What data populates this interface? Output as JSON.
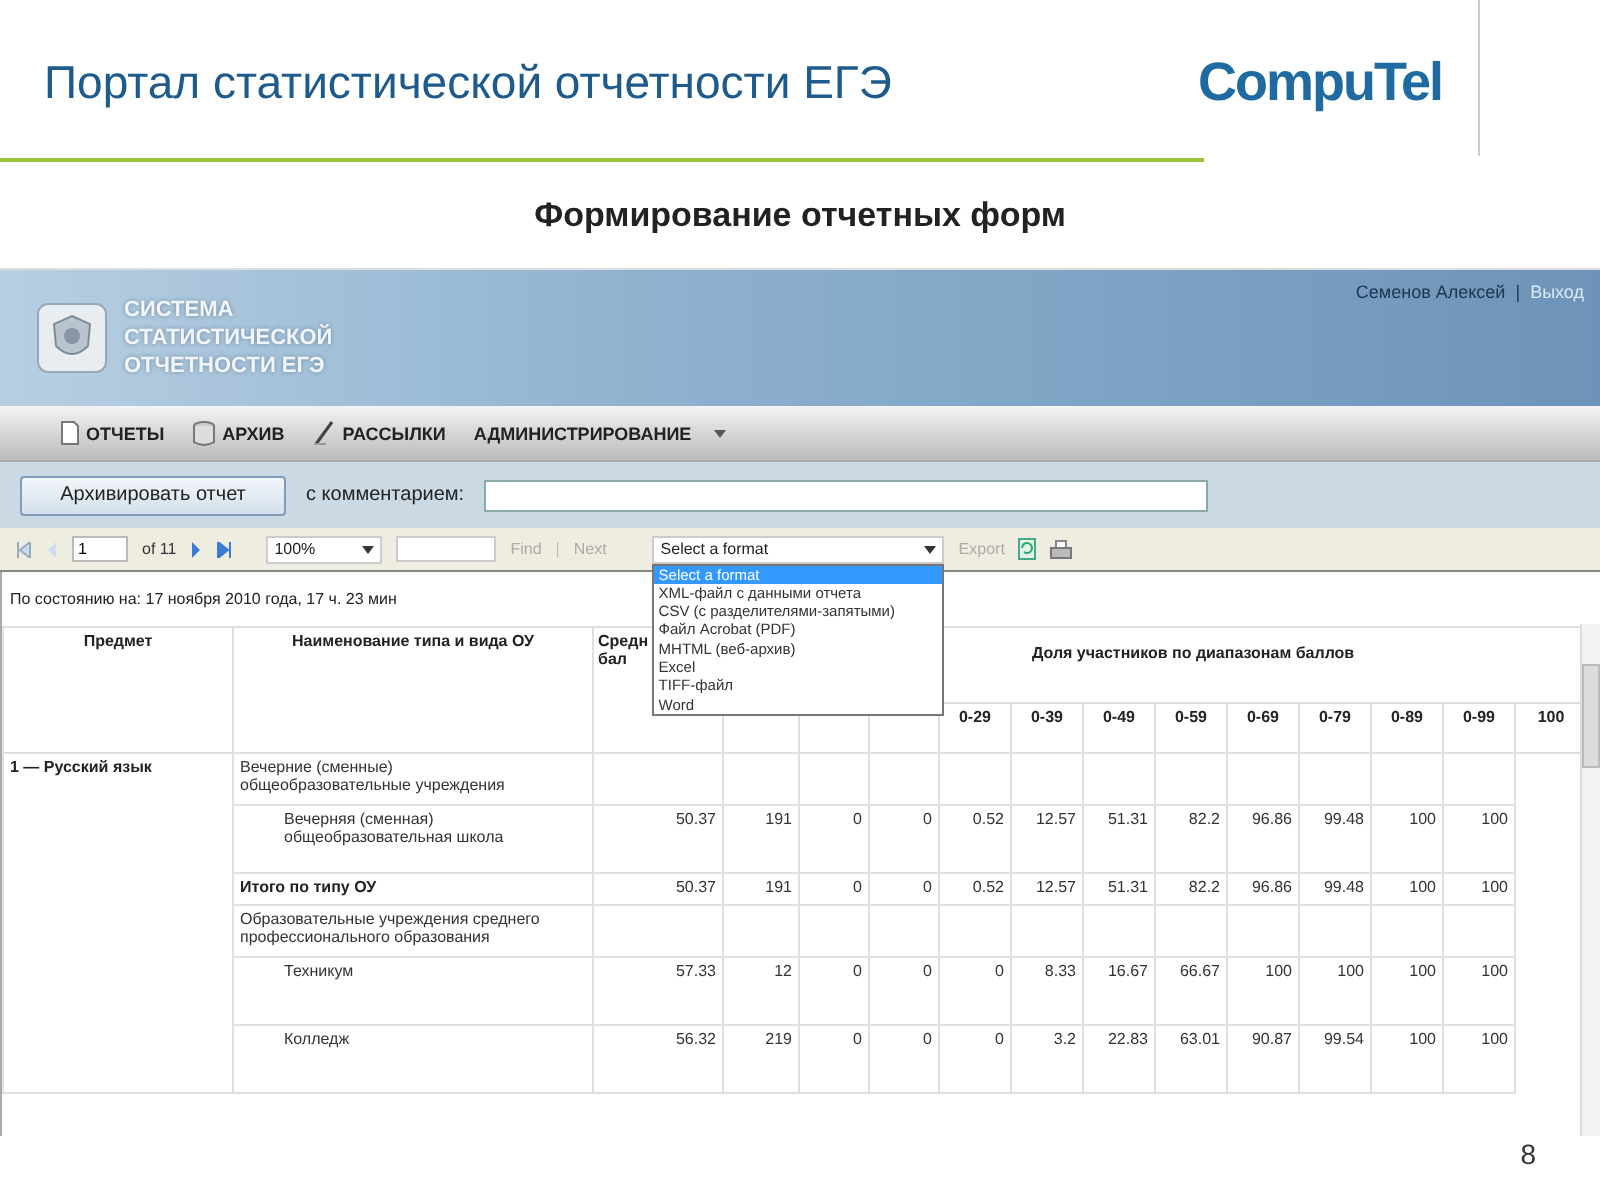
{
  "slide": {
    "title": "Портал статистической отчетности ЕГЭ",
    "logo": "CompuTel",
    "subtitle": "Формирование отчетных форм",
    "page_number": "8"
  },
  "app": {
    "system_name": "СИСТЕМА СТАТИСТИЧЕСКОЙ ОТЧЕТНОСТИ ЕГЭ",
    "user": "Семенов Алексей",
    "separator": "|",
    "logout": "Выход"
  },
  "menu": [
    {
      "label": "ОТЧЕТЫ",
      "kind": "page",
      "dropdown": false
    },
    {
      "label": "АРХИВ",
      "kind": "archive",
      "dropdown": false
    },
    {
      "label": "РАССЫЛКИ",
      "kind": "pen",
      "dropdown": false
    },
    {
      "label": "АДМИНИСТРИРОВАНИЕ",
      "kind": "none",
      "dropdown": true
    }
  ],
  "archive_bar": {
    "button": "Архивировать отчет",
    "comment_label": "с комментарием:"
  },
  "toolbar": {
    "page": "1",
    "page_count": "of 11",
    "zoom": "100%",
    "find": "Find",
    "find_separator": "|",
    "next": "Next",
    "format": "Select a format",
    "format_open": true,
    "export": "Export",
    "format_options": [
      {
        "label": "Select a format",
        "selected": true
      },
      {
        "label": "XML-файл с данными отчета",
        "selected": false
      },
      {
        "label": "CSV (с разделителями-запятыми)",
        "selected": false
      },
      {
        "label": "Файл Acrobat (PDF)",
        "selected": false
      },
      {
        "label": "MHTML (веб-архив)",
        "selected": false
      },
      {
        "label": "Excel",
        "selected": false
      },
      {
        "label": "TIFF-файл",
        "selected": false
      },
      {
        "label": "Word",
        "selected": false
      }
    ]
  },
  "status": "По состоянию на: 17 ноября 2010 года, 17 ч. 23 мин",
  "table": {
    "column_1": "Предмет",
    "column_2": "Наименование типа и вида ОУ",
    "column_3": "Средн бал",
    "group_header": "Доля участников по диапазонам баллов",
    "ranges": [
      "0-29",
      "0-39",
      "0-49",
      "0-59",
      "0-69",
      "0-79",
      "0-89",
      "0-99",
      "100"
    ],
    "subject": "1 — Русский язык",
    "rows": [
      {
        "kind": "group",
        "name": "Вечерние (сменные) общеобразовательные учреждения",
        "values": []
      },
      {
        "kind": "item",
        "name": "Вечерняя (сменная) общеобразовательная школа",
        "values": [
          "50.37",
          "191",
          "0",
          "0",
          "0.52",
          "12.57",
          "51.31",
          "82.2",
          "96.86",
          "99.48",
          "100",
          "100"
        ]
      },
      {
        "kind": "total",
        "name": "Итого по типу ОУ",
        "values": [
          "50.37",
          "191",
          "0",
          "0",
          "0.52",
          "12.57",
          "51.31",
          "82.2",
          "96.86",
          "99.48",
          "100",
          "100"
        ]
      },
      {
        "kind": "group",
        "name": "Образовательные учреждения среднего профессионального образования",
        "values": []
      },
      {
        "kind": "item",
        "name": "Техникум",
        "values": [
          "57.33",
          "12",
          "0",
          "0",
          "0",
          "8.33",
          "16.67",
          "66.67",
          "100",
          "100",
          "100",
          "100"
        ]
      },
      {
        "kind": "item",
        "name": "Колледж",
        "values": [
          "56.32",
          "219",
          "0",
          "0",
          "0",
          "3.2",
          "22.83",
          "63.01",
          "90.87",
          "99.54",
          "100",
          "100"
        ]
      }
    ]
  }
}
